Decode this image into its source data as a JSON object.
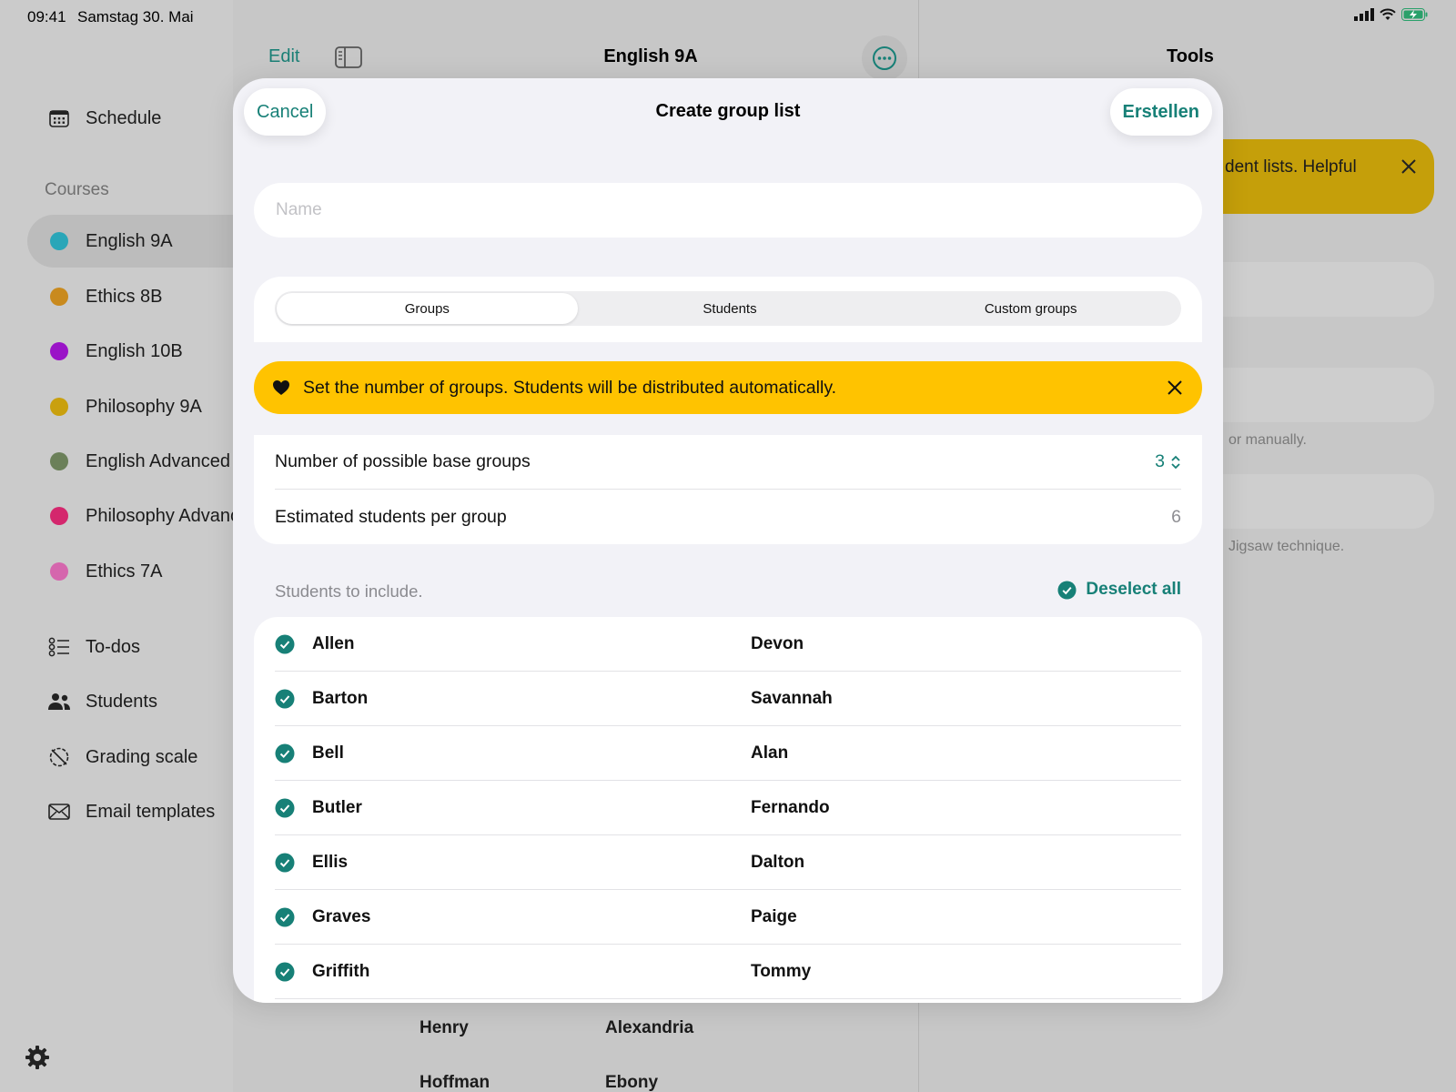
{
  "status_bar": {
    "time": "09:41",
    "date": "Samstag 30. Mai"
  },
  "sidebar": {
    "schedule_label": "Schedule",
    "courses_heading": "Courses",
    "courses": [
      {
        "label": "English 9A",
        "color": "#2aa6b8",
        "active": true
      },
      {
        "label": "Ethics 8B",
        "color": "#c98a1e"
      },
      {
        "label": "English 10B",
        "color": "#9a14c7"
      },
      {
        "label": "Philosophy 9A",
        "color": "#c9a00e"
      },
      {
        "label": "English Advanced",
        "color": "#6b8059"
      },
      {
        "label": "Philosophy Advanced",
        "color": "#d4276d"
      },
      {
        "label": "Ethics 7A",
        "color": "#d566ad"
      }
    ],
    "tools": [
      {
        "label": "To-dos",
        "icon": "checklist-icon"
      },
      {
        "label": "Students",
        "icon": "people-icon"
      },
      {
        "label": "Grading scale",
        "icon": "grading-scale-icon"
      },
      {
        "label": "Email templates",
        "icon": "envelope-icon"
      }
    ]
  },
  "main": {
    "edit_label": "Edit",
    "title": "English 9A",
    "bg_rows": [
      {
        "last": "Henry",
        "first": "Alexandria"
      },
      {
        "last": "Hoffman",
        "first": "Ebony"
      }
    ]
  },
  "tools_pane": {
    "title": "Tools",
    "banner_text": "dent lists. Helpful",
    "caption_1": "or manually.",
    "caption_2": "Jigsaw technique."
  },
  "modal": {
    "cancel_label": "Cancel",
    "title": "Create group list",
    "create_label": "Erstellen",
    "name_placeholder": "Name",
    "name_value": "",
    "segments": [
      {
        "label": "Groups",
        "active": true
      },
      {
        "label": "Students"
      },
      {
        "label": "Custom groups"
      }
    ],
    "hint_text": "Set the number of groups. Students will be distributed automatically.",
    "groups_label": "Number of possible base groups",
    "groups_value": "3",
    "per_group_label": "Estimated students per group",
    "per_group_value": "6",
    "include_label": "Students to include.",
    "deselect_label": "Deselect all",
    "students": [
      {
        "last": "Allen",
        "first": "Devon"
      },
      {
        "last": "Barton",
        "first": "Savannah"
      },
      {
        "last": "Bell",
        "first": "Alan"
      },
      {
        "last": "Butler",
        "first": "Fernando"
      },
      {
        "last": "Ellis",
        "first": "Dalton"
      },
      {
        "last": "Graves",
        "first": "Paige"
      },
      {
        "last": "Griffith",
        "first": "Tommy"
      }
    ]
  },
  "colors": {
    "accent": "#178077",
    "hint": "#ffc300"
  }
}
